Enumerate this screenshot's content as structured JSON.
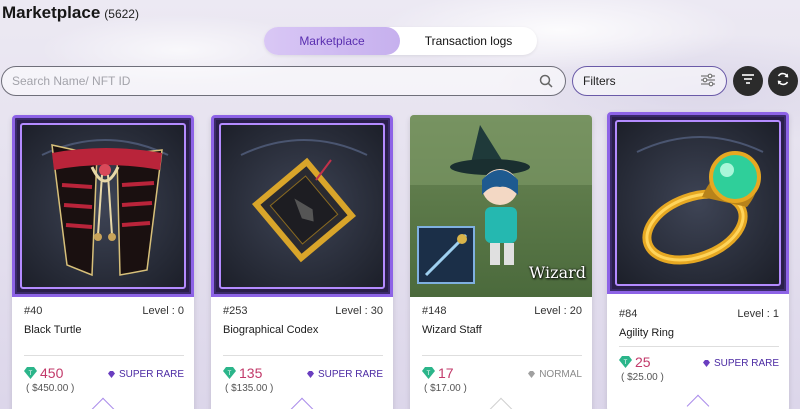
{
  "header": {
    "title": "Marketplace",
    "count": "(5622)"
  },
  "tabs": [
    {
      "label": "Marketplace",
      "active": true
    },
    {
      "label": "Transaction logs",
      "active": false
    }
  ],
  "search": {
    "placeholder": "Search Name/ NFT ID",
    "value": "",
    "icon": "search-icon"
  },
  "filters": {
    "label": "Filters",
    "icon": "sliders-icon"
  },
  "buttons": {
    "sort_icon": "sort-icon",
    "refresh_icon": "refresh-icon"
  },
  "colors": {
    "accent": "#8d63e6",
    "price": "#c23a6a",
    "rare": "#4b2aa3"
  },
  "cards": [
    {
      "id": "#40",
      "level": "Level : 0",
      "name": "Black Turtle",
      "price": "450",
      "usd": "( $450.00 )",
      "rarity": "SUPER RARE"
    },
    {
      "id": "#253",
      "level": "Level : 30",
      "name": "Biographical Codex",
      "price": "135",
      "usd": "( $135.00 )",
      "rarity": "SUPER RARE"
    },
    {
      "id": "#148",
      "level": "Level : 20",
      "name": "Wizard Staff",
      "price": "17",
      "usd": "( $17.00 )",
      "rarity": "NORMAL",
      "art_label": "Wizard"
    },
    {
      "id": "#84",
      "level": "Level : 1",
      "name": "Agility Ring",
      "price": "25",
      "usd": "( $25.00 )",
      "rarity": "SUPER RARE"
    }
  ]
}
